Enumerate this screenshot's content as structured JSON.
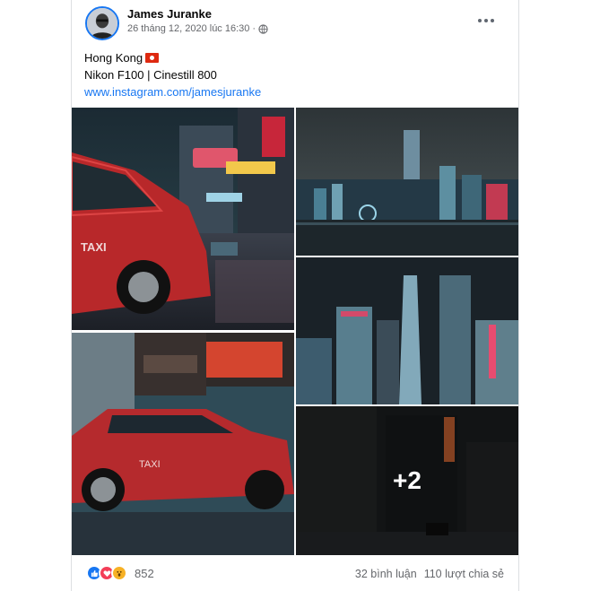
{
  "post": {
    "author": "James Juranke",
    "timestamp": "26 tháng 12, 2020 lúc 16:30",
    "separator": "·",
    "privacy_icon": "globe-icon",
    "more_icon": "more-options-icon",
    "caption": {
      "line1": "Hong Kong",
      "flag_icon": "hong-kong-flag-icon",
      "line2": "Nikon F100 | Cinestill 800",
      "link": "www.instagram.com/jamesjuranke"
    },
    "photos": {
      "overflow_label": "+2"
    },
    "footer": {
      "reaction_icons": [
        "like-icon",
        "love-icon",
        "wow-icon"
      ],
      "reaction_count": "852",
      "comments": "32 bình luận",
      "shares": "110 lượt chia sẻ"
    }
  },
  "colors": {
    "accent": "#1877f2",
    "secondary_text": "#65676b",
    "like": "#1877f2",
    "love": "#f33e58",
    "wow": "#f7b125"
  }
}
